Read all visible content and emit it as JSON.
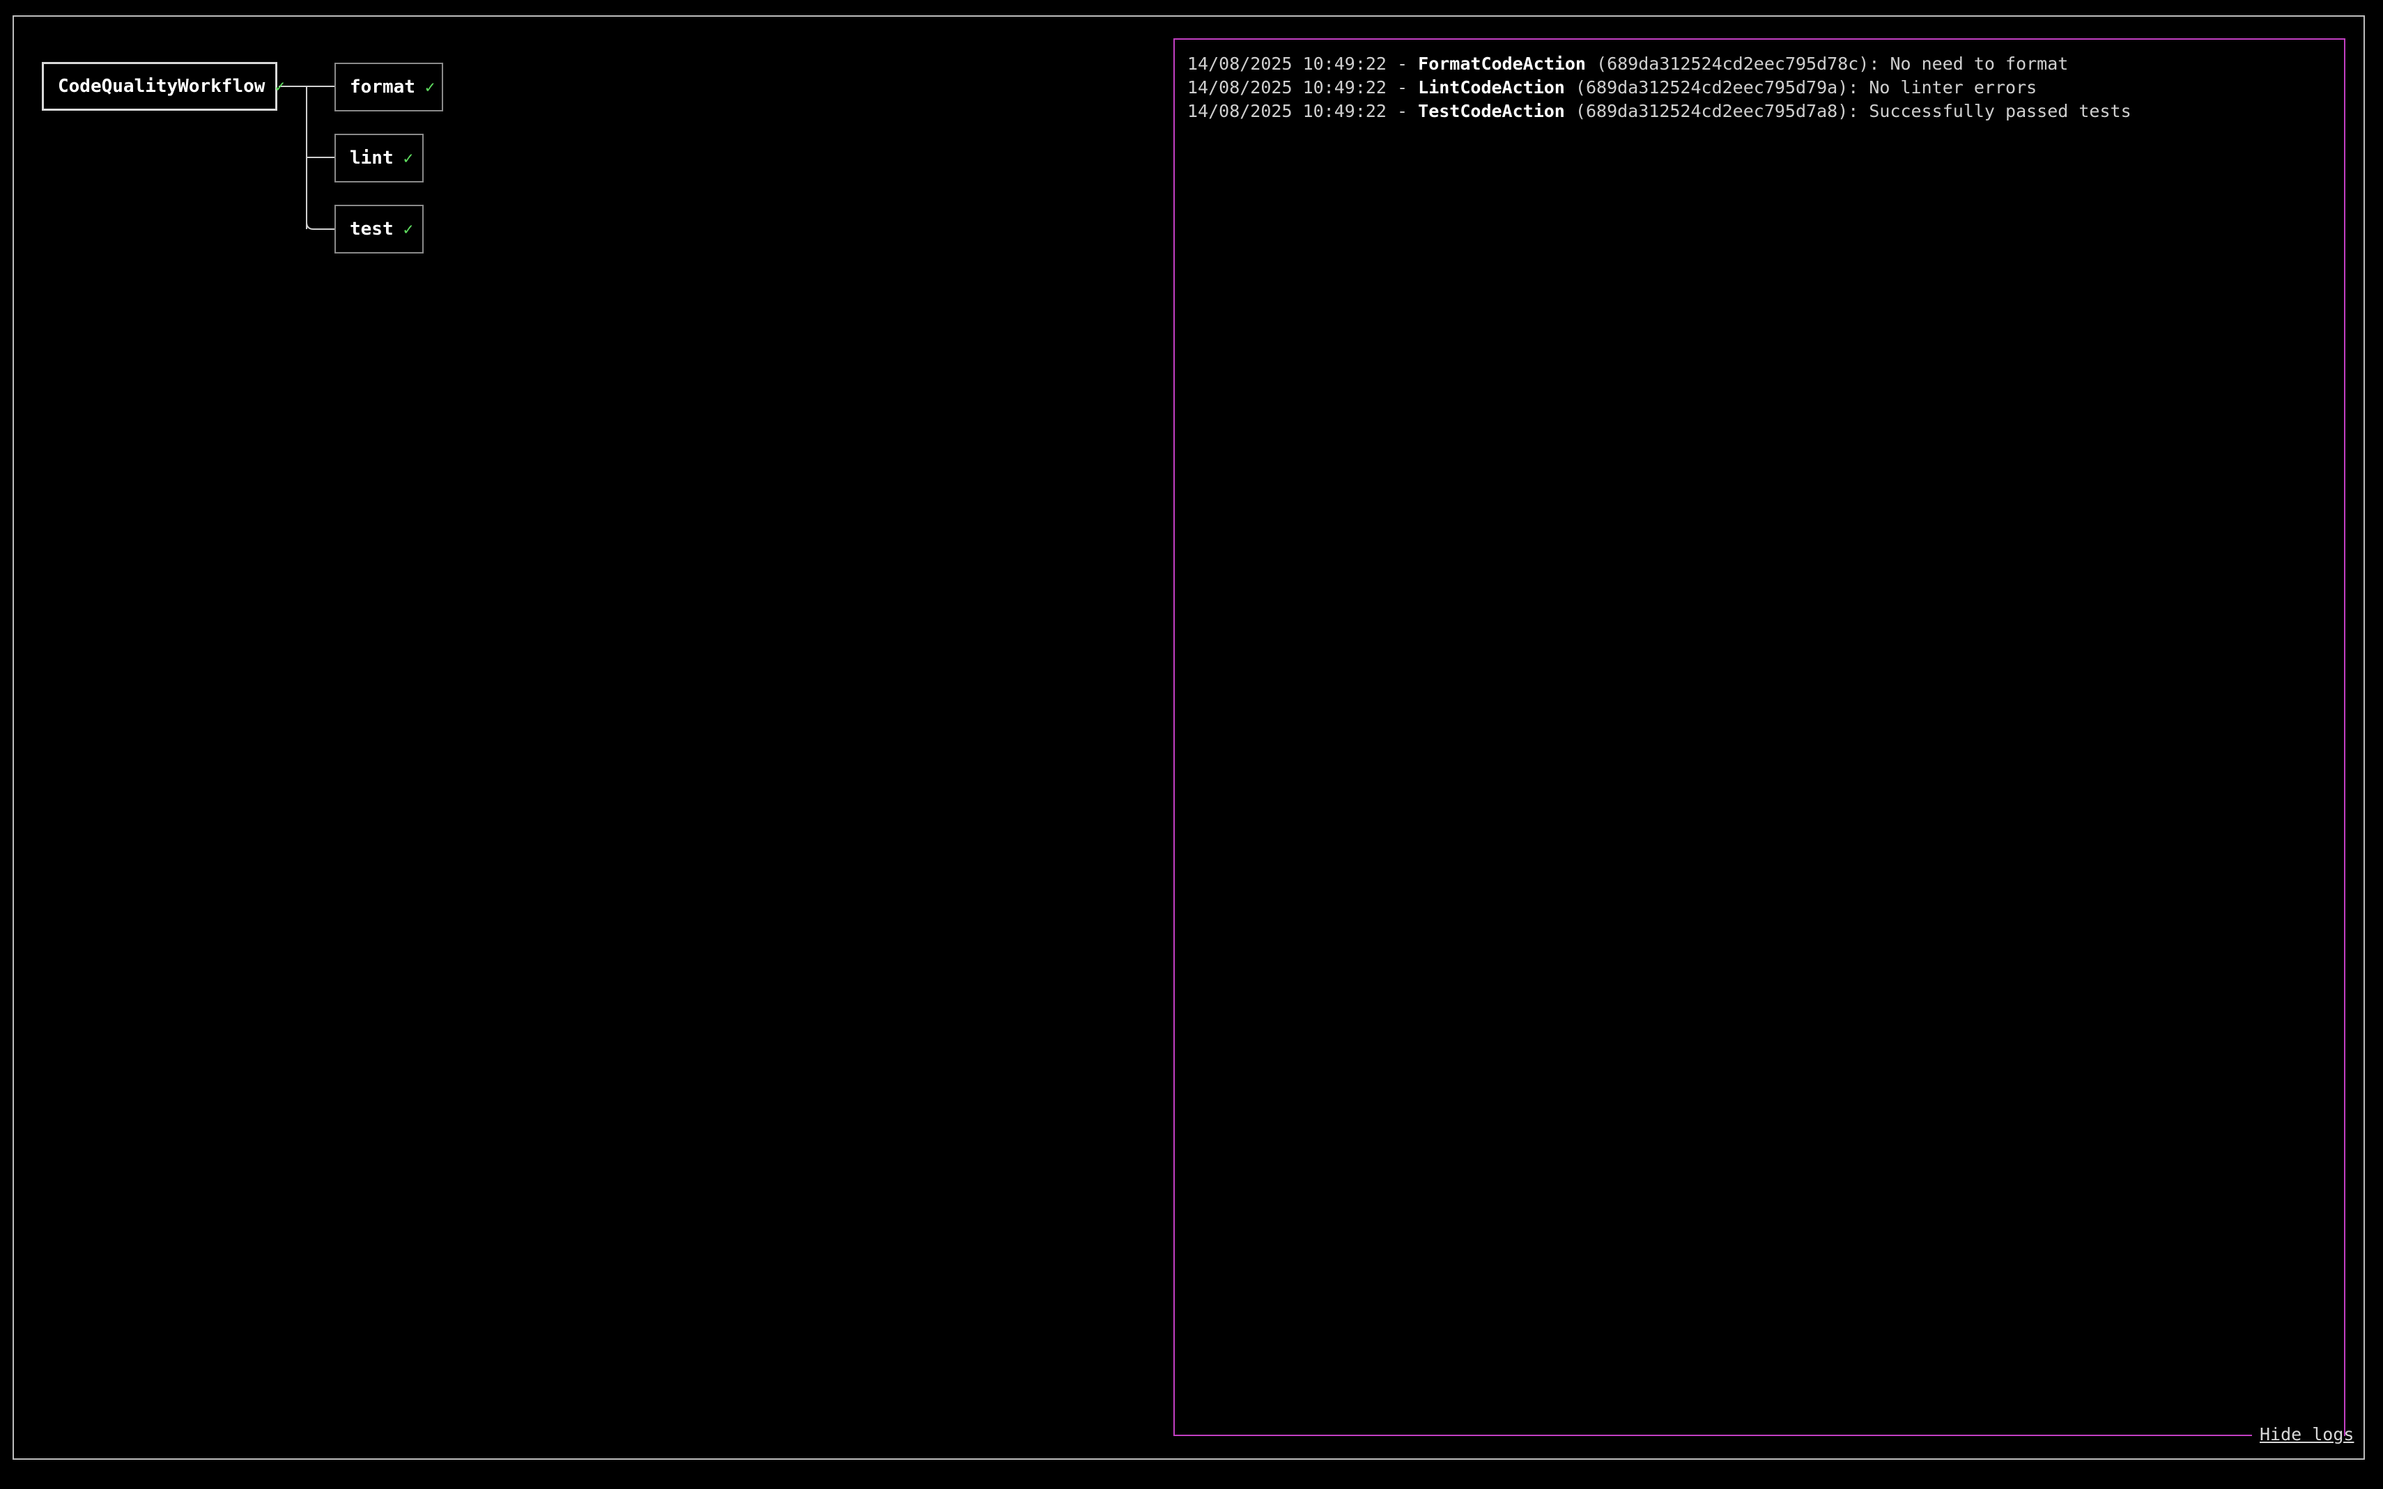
{
  "workflow": {
    "root": {
      "label": "CodeQualityWorkflow",
      "status_icon": "✓"
    },
    "children": [
      {
        "label": "format",
        "status_icon": "✓"
      },
      {
        "label": "lint",
        "status_icon": "✓"
      },
      {
        "label": "test",
        "status_icon": "✓"
      }
    ]
  },
  "logs": {
    "entries": [
      {
        "timestamp": "14/08/2025 10:49:22",
        "separator": " - ",
        "action": "FormatCodeAction",
        "id": " (689da312524cd2eec795d78c)",
        "message": ": No need to format"
      },
      {
        "timestamp": "14/08/2025 10:49:22",
        "separator": " - ",
        "action": "LintCodeAction",
        "id": " (689da312524cd2eec795d79a)",
        "message": ": No linter errors"
      },
      {
        "timestamp": "14/08/2025 10:49:22",
        "separator": " - ",
        "action": "TestCodeAction",
        "id": " (689da312524cd2eec795d7a8)",
        "message": ": Successfully passed tests"
      }
    ],
    "hide_label": "Hide logs"
  },
  "colors": {
    "success": "#5fdc5f",
    "log_border": "#c23fc2",
    "background": "#000000"
  }
}
